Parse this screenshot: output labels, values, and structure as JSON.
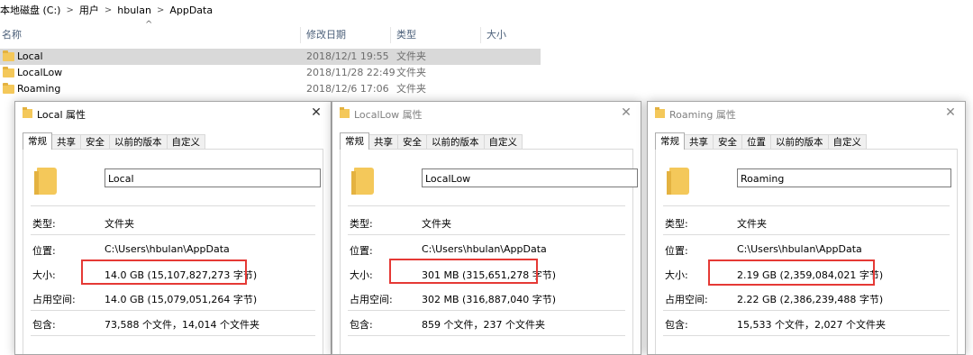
{
  "explorer": {
    "breadcrumb": [
      "本地磁盘 (C:)",
      "用户",
      "hbulan",
      "AppData"
    ],
    "breadcrumb_separator": ">",
    "sort_arrow": "^",
    "columns": {
      "name": "名称",
      "date": "修改日期",
      "type": "类型",
      "size": "大小"
    },
    "rows": [
      {
        "name": "Local",
        "date": "2018/12/1 19:55",
        "type": "文件夹",
        "selected": true
      },
      {
        "name": "LocalLow",
        "date": "2018/11/28 22:49",
        "type": "文件夹",
        "selected": false
      },
      {
        "name": "Roaming",
        "date": "2018/12/6 17:06",
        "type": "文件夹",
        "selected": false
      }
    ]
  },
  "common": {
    "close_glyph": "✕",
    "tab_general": "常规",
    "tab_sharing": "共享",
    "tab_security": "安全",
    "tab_location": "位置",
    "tab_previous": "以前的版本",
    "tab_custom": "自定义",
    "label_type": "类型:",
    "label_location": "位置:",
    "label_size": "大小:",
    "label_size_on_disk": "占用空间:",
    "label_contains": "包含:"
  },
  "dialogs": [
    {
      "title": "Local 属性",
      "name": "Local",
      "type": "文件夹",
      "location": "C:\\Users\\hbulan\\AppData",
      "size": "14.0 GB (15,107,827,273 字节)",
      "size_on_disk": "14.0 GB (15,079,051,264 字节)",
      "contains": "73,588 个文件，14,014 个文件夹"
    },
    {
      "title": "LocalLow 属性",
      "name": "LocalLow",
      "type": "文件夹",
      "location": "C:\\Users\\hbulan\\AppData",
      "size": "301 MB (315,651,278 字节)",
      "size_on_disk": "302 MB (316,887,040 字节)",
      "contains": "859 个文件，237 个文件夹"
    },
    {
      "title": "Roaming 属性",
      "name": "Roaming",
      "type": "文件夹",
      "location": "C:\\Users\\hbulan\\AppData",
      "size": "2.19 GB (2,359,084,021 字节)",
      "size_on_disk": "2.22 GB (2,386,239,488 字节)",
      "contains": "15,533 个文件，2,027 个文件夹"
    }
  ]
}
